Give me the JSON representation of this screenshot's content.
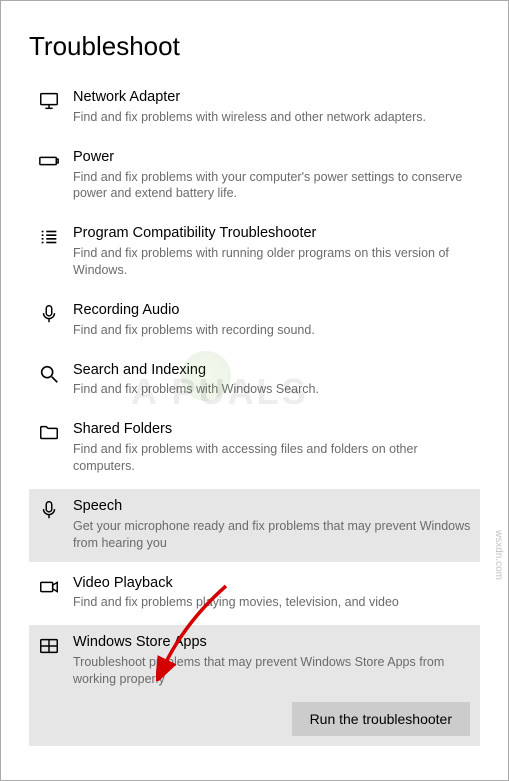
{
  "page_title": "Troubleshoot",
  "items": [
    {
      "title": "Network Adapter",
      "desc": "Find and fix problems with wireless and other network adapters.",
      "icon": "monitor-icon",
      "selected": false,
      "expanded": false
    },
    {
      "title": "Power",
      "desc": "Find and fix problems with your computer's power settings to conserve power and extend battery life.",
      "icon": "battery-icon",
      "selected": false,
      "expanded": false
    },
    {
      "title": "Program Compatibility Troubleshooter",
      "desc": "Find and fix problems with running older programs on this version of Windows.",
      "icon": "list-icon",
      "selected": false,
      "expanded": false
    },
    {
      "title": "Recording Audio",
      "desc": "Find and fix problems with recording sound.",
      "icon": "microphone-icon",
      "selected": false,
      "expanded": false
    },
    {
      "title": "Search and Indexing",
      "desc": "Find and fix problems with Windows Search.",
      "icon": "search-icon",
      "selected": false,
      "expanded": false
    },
    {
      "title": "Shared Folders",
      "desc": "Find and fix problems with accessing files and folders on other computers.",
      "icon": "folder-icon",
      "selected": false,
      "expanded": false
    },
    {
      "title": "Speech",
      "desc": "Get your microphone ready and fix problems that may prevent Windows from hearing you",
      "icon": "microphone-icon",
      "selected": true,
      "expanded": false
    },
    {
      "title": "Video Playback",
      "desc": "Find and fix problems playing movies, television, and video",
      "icon": "video-icon",
      "selected": false,
      "expanded": false
    },
    {
      "title": "Windows Store Apps",
      "desc": "Troubleshoot problems that may prevent Windows Store Apps from working properly",
      "icon": "store-icon",
      "selected": false,
      "expanded": true
    }
  ],
  "run_button_label": "Run the troubleshooter",
  "watermark_text": "A   PUALS",
  "attribution": "wsxdn.com"
}
